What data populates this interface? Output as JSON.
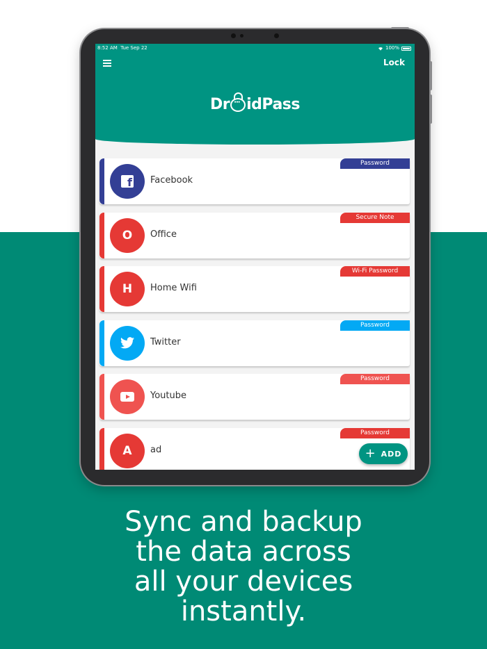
{
  "status_bar": {
    "time": "8:52 AM",
    "date": "Tue Sep 22",
    "battery": "100%"
  },
  "header": {
    "lock_label": "Lock",
    "logo_prefix": "Dr",
    "logo_suffix": "idPass"
  },
  "entries": [
    {
      "name": "Facebook",
      "badge": "Password",
      "avatar": "facebook-icon",
      "avatar_color": "#333f95",
      "stripe_color": "#333f95",
      "badge_color": "#333f95"
    },
    {
      "name": "Office",
      "badge": "Secure Note",
      "avatar_letter": "O",
      "avatar_color": "#e53935",
      "stripe_color": "#e53935",
      "badge_color": "#e53935"
    },
    {
      "name": "Home Wifi",
      "badge": "Wi-Fi Password",
      "avatar_letter": "H",
      "avatar_color": "#e53935",
      "stripe_color": "#e53935",
      "badge_color": "#e53935"
    },
    {
      "name": "Twitter",
      "badge": "Password",
      "avatar": "twitter-icon",
      "avatar_color": "#03a9f4",
      "stripe_color": "#03a9f4",
      "badge_color": "#03a9f4"
    },
    {
      "name": "Youtube",
      "badge": "Password",
      "avatar": "youtube-icon",
      "avatar_color": "#ef5350",
      "stripe_color": "#ef5350",
      "badge_color": "#ef5350"
    },
    {
      "name": "ad",
      "badge": "Password",
      "avatar_letter": "A",
      "avatar_color": "#e53935",
      "stripe_color": "#e53935",
      "badge_color": "#e53935"
    }
  ],
  "fab": {
    "label": "ADD"
  },
  "tagline": [
    "Sync and backup",
    "the data across",
    "all your devices",
    "instantly."
  ],
  "colors": {
    "brand": "#009482",
    "page_bottom": "#008a75"
  }
}
